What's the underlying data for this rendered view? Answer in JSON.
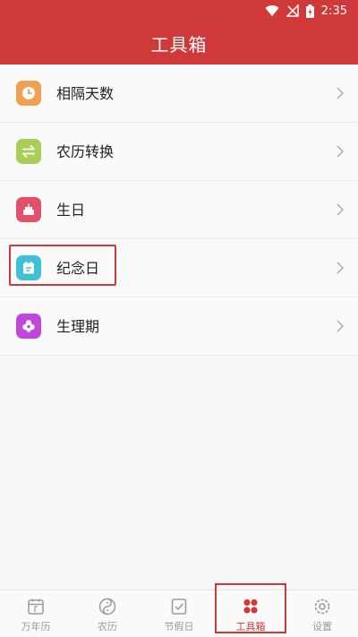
{
  "status_bar": {
    "time": "2:35"
  },
  "header": {
    "title": "工具箱"
  },
  "tools": [
    {
      "label": "相隔天数",
      "icon": "clock-icon",
      "color": "#f0a050"
    },
    {
      "label": "农历转换",
      "icon": "convert-arrows-icon",
      "color": "#a8cf58"
    },
    {
      "label": "生日",
      "icon": "cake-icon",
      "color": "#e4506a"
    },
    {
      "label": "纪念日",
      "icon": "calendar-icon",
      "color": "#3ec0d8"
    },
    {
      "label": "生理期",
      "icon": "flower-icon",
      "color": "#c048d8"
    }
  ],
  "tabs": [
    {
      "label": "万年历",
      "icon": "calendar-tab-icon",
      "active": false
    },
    {
      "label": "农历",
      "icon": "yin-yang-icon",
      "active": false
    },
    {
      "label": "节假日",
      "icon": "checklist-icon",
      "active": false
    },
    {
      "label": "工具箱",
      "icon": "grid-dots-icon",
      "active": true
    },
    {
      "label": "设置",
      "icon": "gear-icon",
      "active": false
    }
  ],
  "colors": {
    "accent": "#d0393a",
    "inactive": "#9a9a9a"
  }
}
